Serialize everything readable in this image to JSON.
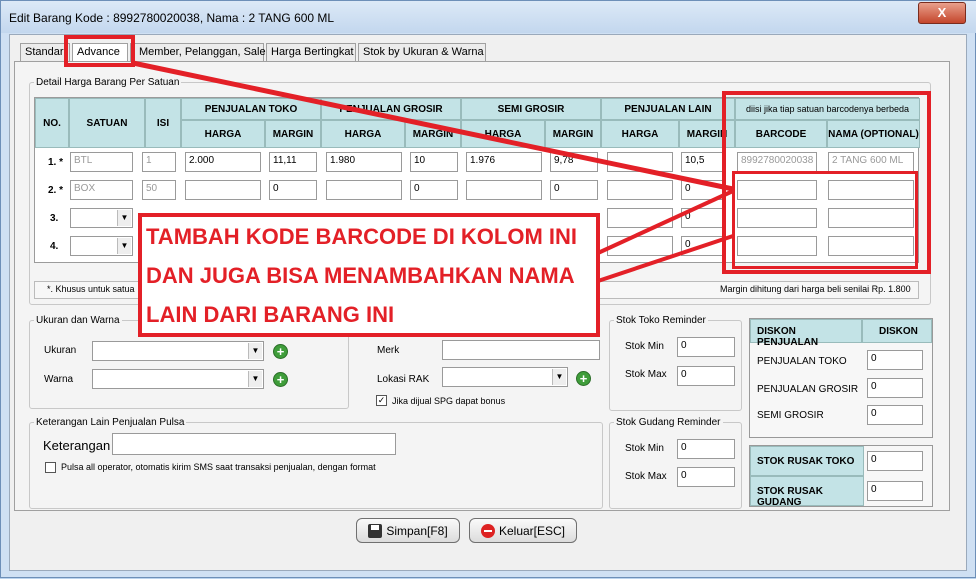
{
  "window": {
    "title": "Edit Barang  Kode : 8992780020038, Nama : 2 TANG 600 ML",
    "close": "X"
  },
  "tabs": [
    "Standar",
    "Advance",
    "Member, Pelanggan, Sales",
    "Harga Bertingkat",
    "Stok by Ukuran & Warna"
  ],
  "detail": {
    "legend": "Detail Harga Barang Per Satuan",
    "note": "diisi jika tiap satuan barcodenya berbeda",
    "headers": {
      "no": "NO.",
      "satuan": "SATUAN",
      "isi": "ISI",
      "jual_toko": "PENJUALAN TOKO",
      "jual_grosir": "PENJUALAN GROSIR",
      "semi_grosir": "SEMI GROSIR",
      "jual_lain": "PENJUALAN LAIN",
      "harga": "HARGA",
      "margin": "MARGIN",
      "barcode": "BARCODE",
      "nama": "NAMA (OPTIONAL)"
    },
    "rows": [
      {
        "no": "1. *",
        "satuan": "BTL",
        "isi": "1",
        "h1": "2.000",
        "m1": "11,11",
        "h2": "1.980",
        "m2": "10",
        "h3": "1.976",
        "m3": "9,78",
        "h4": "",
        "m4": "10,5",
        "barcode": "8992780020038",
        "nama": "2 TANG 600 ML"
      },
      {
        "no": "2. *",
        "satuan": "BOX",
        "isi": "50",
        "h1": "",
        "m1": "0",
        "h2": "",
        "m2": "0",
        "h3": "",
        "m3": "0",
        "h4": "",
        "m4": "0",
        "barcode": "",
        "nama": ""
      },
      {
        "no": "3.",
        "satuan": "",
        "isi": "",
        "h1": "",
        "m1": "",
        "h2": "",
        "m2": "",
        "h3": "",
        "m3": "",
        "h4": "",
        "m4": "0",
        "barcode": "",
        "nama": ""
      },
      {
        "no": "4.",
        "satuan": "",
        "isi": "",
        "h1": "",
        "m1": "",
        "h2": "",
        "m2": "",
        "h3": "",
        "m3": "",
        "h4": "",
        "m4": "0",
        "barcode": "",
        "nama": ""
      }
    ],
    "footer_left": "*. Khusus untuk satua",
    "footer_right": "Margin dihitung dari harga beli senilai Rp. 1.800"
  },
  "ukuran": {
    "legend": "Ukuran dan Warna",
    "ukuran": "Ukuran",
    "warna": "Warna"
  },
  "merk": {
    "merk": "Merk",
    "lokasi": "Lokasi RAK",
    "spg": "Jika dijual SPG dapat bonus"
  },
  "stok_toko": {
    "legend": "Stok Toko Reminder",
    "min": "Stok Min",
    "max": "Stok Max",
    "min_val": "0",
    "max_val": "0"
  },
  "stok_gudang": {
    "legend": "Stok Gudang Reminder",
    "min": "Stok Min",
    "max": "Stok Max",
    "min_val": "0",
    "max_val": "0"
  },
  "diskon": {
    "h1": "DISKON PENJUALAN",
    "h2": "DISKON",
    "r1": "PENJUALAN TOKO",
    "r2": "PENJUALAN GROSIR",
    "r3": "SEMI GROSIR",
    "v1": "0",
    "v2": "0",
    "v3": "0"
  },
  "rusak": {
    "toko": "STOK RUSAK TOKO",
    "gudang": "STOK RUSAK GUDANG",
    "v1": "0",
    "v2": "0"
  },
  "ket": {
    "legend": "Keterangan Lain  Penjualan Pulsa",
    "label": "Keterangan",
    "pulsa": "Pulsa all operator, otomatis kirim SMS saat transaksi penjualan, dengan format"
  },
  "buttons": {
    "simpan": "Simpan[F8]",
    "keluar": "Keluar[ESC]"
  },
  "annotation": "TAMBAH KODE BARCODE DI KOLOM INI DAN JUGA BISA MENAMBAHKAN NAMA LAIN DARI BARANG INI",
  "colors": {
    "annotation": "#e32027",
    "header": "#c3e3e6"
  }
}
